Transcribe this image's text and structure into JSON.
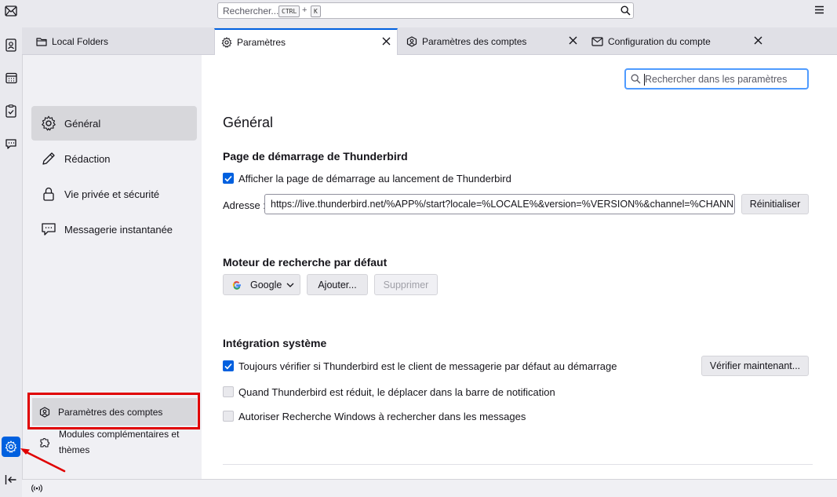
{
  "search": {
    "placeholder": "Rechercher...",
    "kbd1": "CTRL",
    "plus": "+",
    "kbd2": "K"
  },
  "tabs": [
    {
      "label": "Local Folders",
      "icon": "folder-icon"
    },
    {
      "label": "Paramètres",
      "icon": "gear-icon",
      "selected": true
    },
    {
      "label": "Paramètres des comptes",
      "icon": "account-icon"
    },
    {
      "label": "Configuration du compte",
      "icon": "mail-icon"
    }
  ],
  "nav": {
    "items": [
      {
        "label": "Général",
        "icon": "gear-icon",
        "selected": true
      },
      {
        "label": "Rédaction",
        "icon": "pencil-icon"
      },
      {
        "label": "Vie privée et sécurité",
        "icon": "lock-icon"
      },
      {
        "label": "Messagerie instantanée",
        "icon": "chat-icon"
      }
    ],
    "accounts_label": "Paramètres des comptes",
    "addons_label": "Modules complémentaires et thèmes"
  },
  "main": {
    "search_placeholder": "Rechercher dans les paramètres",
    "title": "Général",
    "startpage": {
      "heading": "Page de démarrage de Thunderbird",
      "checkbox_label": "Afficher la page de démarrage au lancement de Thunderbird",
      "checked": true,
      "address_label": "Adresse :",
      "address_value": "https://live.thunderbird.net/%APP%/start?locale=%LOCALE%&version=%VERSION%&channel=%CHANNEL%",
      "reset_label": "Réinitialiser"
    },
    "search_engine": {
      "heading": "Moteur de recherche par défaut",
      "engine": "Google",
      "add_label": "Ajouter...",
      "remove_label": "Supprimer"
    },
    "system": {
      "heading": "Intégration système",
      "options": [
        {
          "label": "Toujours vérifier si Thunderbird est le client de messagerie par défaut au démarrage",
          "checked": true
        },
        {
          "label": "Quand Thunderbird est réduit, le déplacer dans la barre de notification",
          "checked": false
        },
        {
          "label": "Autoriser Recherche Windows à rechercher dans les messages",
          "checked": false
        }
      ],
      "check_now_label": "Vérifier maintenant..."
    }
  },
  "colors": {
    "accent": "#0060df",
    "highlight": "#e00000"
  }
}
